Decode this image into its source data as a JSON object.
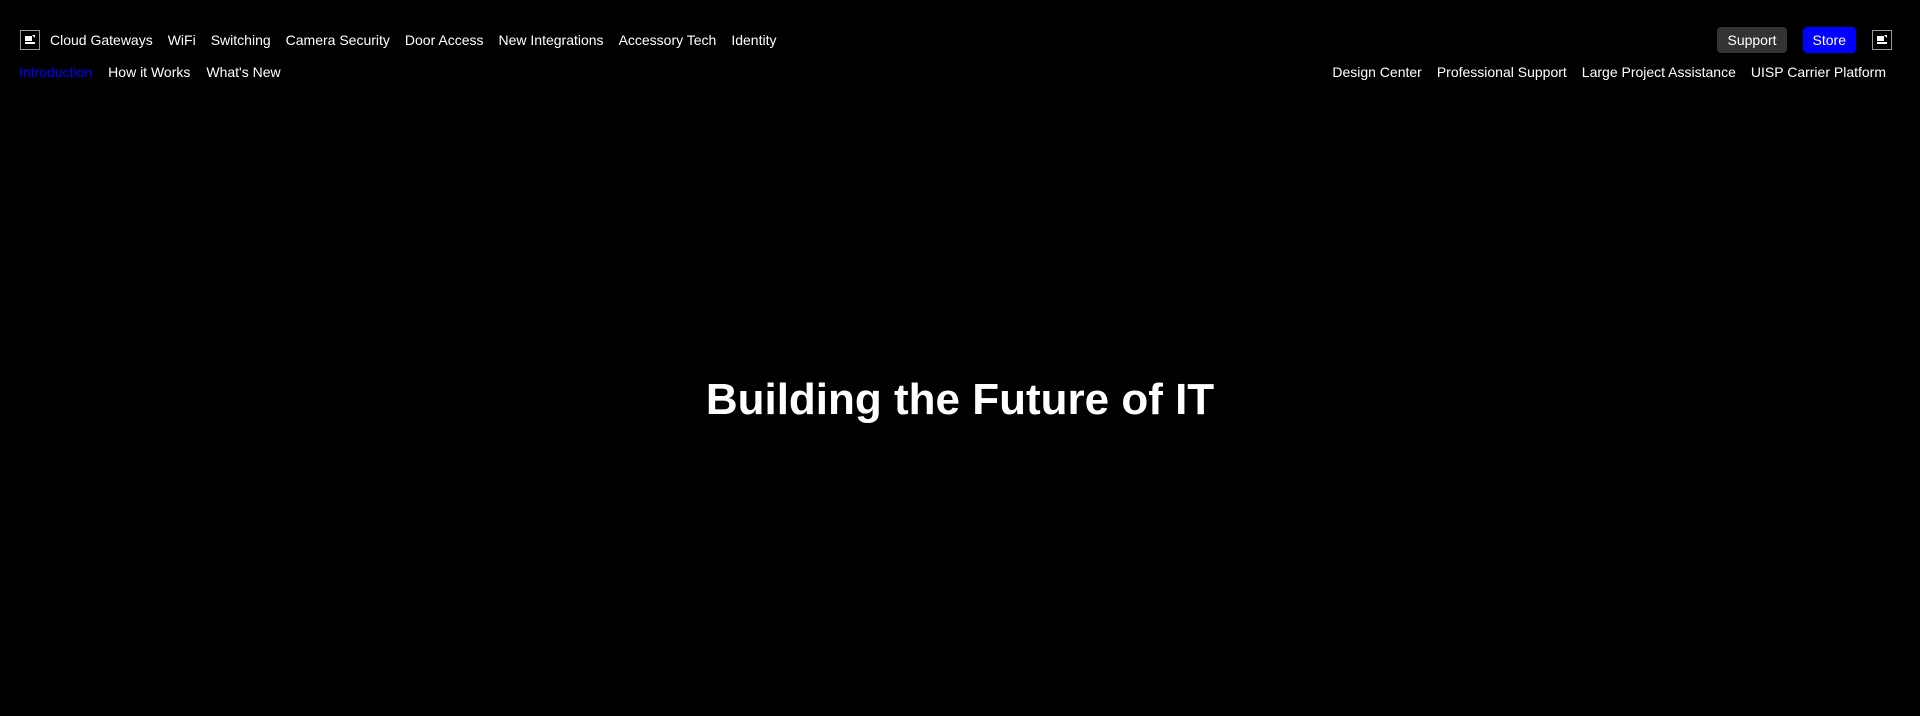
{
  "header": {
    "logo_icon": "broken-image-icon",
    "nav": [
      {
        "label": "Cloud Gateways"
      },
      {
        "label": "WiFi"
      },
      {
        "label": "Switching"
      },
      {
        "label": "Camera Security"
      },
      {
        "label": "Door Access"
      },
      {
        "label": "New Integrations"
      },
      {
        "label": "Accessory Tech"
      },
      {
        "label": "Identity"
      }
    ],
    "support_label": "Support",
    "store_label": "Store",
    "account_icon": "broken-image-icon"
  },
  "subnav": {
    "left": [
      {
        "label": "Introduction",
        "active": true
      },
      {
        "label": "How it Works"
      },
      {
        "label": "What's New"
      }
    ],
    "right": [
      {
        "label": "Design Center"
      },
      {
        "label": "Professional Support"
      },
      {
        "label": "Large Project Assistance"
      },
      {
        "label": "UISP Carrier Platform"
      }
    ]
  },
  "hero": {
    "title": "Building the Future of IT"
  },
  "colors": {
    "background": "#000000",
    "text": "#ffffff",
    "accent": "#0000ff",
    "support_button": "#333333"
  }
}
